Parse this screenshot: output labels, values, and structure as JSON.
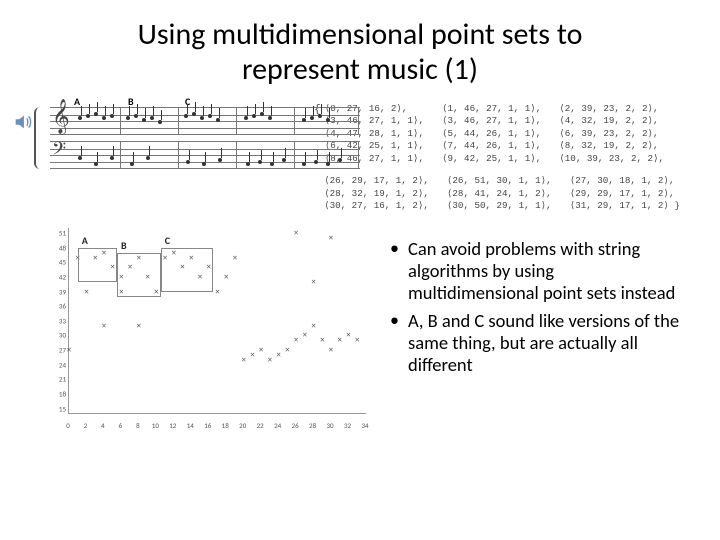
{
  "title_line1": "Using multidimensional point sets to",
  "title_line2": "represent music (1)",
  "motifs": {
    "A": "A",
    "B": "B",
    "C": "C"
  },
  "tuples": {
    "group1": {
      "col1": "⟨0, 27, 16, 2⟩,\n⟨3, 46, 27, 1, 1⟩,\n⟨4, 47, 28, 1, 1⟩,\n⟨6, 42, 25, 1, 1⟩,\n⟨8, 46, 27, 1, 1⟩,",
      "col2": "⟨1, 46, 27, 1, 1⟩,\n⟨3, 46, 27, 1, 1⟩,\n⟨5, 44, 26, 1, 1⟩,\n⟨7, 44, 26, 1, 1⟩,\n⟨9, 42, 25, 1, 1⟩,",
      "col3": "⟨2, 39, 23, 2, 2⟩,\n⟨4, 32, 19, 2, 2⟩,\n⟨6, 39, 23, 2, 2⟩,\n⟨8, 32, 19, 2, 2⟩,\n⟨10, 39, 23, 2, 2⟩,"
    },
    "group2": {
      "col1": "⟨26, 29, 17, 1, 2⟩,\n⟨28, 32, 19, 1, 2⟩,\n⟨30, 27, 16, 1, 2⟩,",
      "col2": "⟨26, 51, 30, 1, 1⟩,\n⟨28, 41, 24, 1, 2⟩,\n⟨30, 50, 29, 1, 1⟩,",
      "col3": "⟨27, 30, 18, 1, 2⟩,\n⟨29, 29, 17, 1, 2⟩,\n⟨31, 29, 17, 1, 2⟩ }"
    },
    "open_brace": "{"
  },
  "bullets": {
    "b1": "Can avoid problems with string algorithms by using multidimensional point sets instead",
    "b2": "A, B and C sound like versions of the same thing, but are actually all different"
  },
  "chart_data": {
    "type": "scatter",
    "xlabel": "",
    "ylabel": "",
    "xlim": [
      0,
      34
    ],
    "ylim": [
      14,
      52
    ],
    "xticks": [
      0,
      1,
      2,
      3,
      4,
      5,
      6,
      7,
      8,
      9,
      10,
      11,
      12,
      13,
      14,
      15,
      16,
      17,
      18,
      19,
      20,
      21,
      22,
      23,
      24,
      25,
      26,
      27,
      28,
      29,
      30,
      31,
      32,
      33,
      34
    ],
    "yticks": [
      15,
      16,
      17,
      18,
      19,
      20,
      21,
      22,
      23,
      24,
      25,
      26,
      27,
      28,
      29,
      30,
      31,
      32,
      33,
      34,
      35,
      36,
      37,
      38,
      39,
      40,
      41,
      42,
      43,
      44,
      45,
      46,
      47,
      48,
      49,
      50,
      51
    ],
    "points": [
      [
        0,
        27
      ],
      [
        1,
        46
      ],
      [
        2,
        39
      ],
      [
        3,
        46
      ],
      [
        4,
        47
      ],
      [
        4,
        32
      ],
      [
        5,
        44
      ],
      [
        6,
        42
      ],
      [
        6,
        39
      ],
      [
        7,
        44
      ],
      [
        8,
        46
      ],
      [
        8,
        32
      ],
      [
        9,
        42
      ],
      [
        10,
        39
      ],
      [
        11,
        46
      ],
      [
        12,
        47
      ],
      [
        13,
        44
      ],
      [
        14,
        46
      ],
      [
        15,
        42
      ],
      [
        16,
        44
      ],
      [
        17,
        39
      ],
      [
        18,
        42
      ],
      [
        19,
        46
      ],
      [
        26,
        29
      ],
      [
        26,
        51
      ],
      [
        27,
        30
      ],
      [
        28,
        32
      ],
      [
        28,
        41
      ],
      [
        29,
        29
      ],
      [
        30,
        27
      ],
      [
        30,
        50
      ],
      [
        31,
        29
      ],
      [
        20,
        25
      ],
      [
        21,
        26
      ],
      [
        22,
        27
      ],
      [
        23,
        25
      ],
      [
        24,
        26
      ],
      [
        25,
        27
      ],
      [
        32,
        30
      ],
      [
        33,
        29
      ]
    ],
    "regions": [
      {
        "label": "A",
        "x": [
          1,
          5.5
        ],
        "y": [
          41,
          48
        ]
      },
      {
        "label": "B",
        "x": [
          5.5,
          10.5
        ],
        "y": [
          38,
          47
        ]
      },
      {
        "label": "C",
        "x": [
          10.5,
          16.5
        ],
        "y": [
          39,
          48
        ]
      }
    ]
  }
}
